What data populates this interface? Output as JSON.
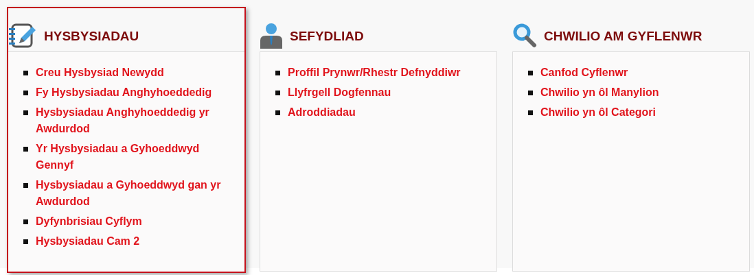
{
  "panels": [
    {
      "title": "HYSBYSIADAU",
      "kind": "notepad",
      "highlighted": true,
      "links": [
        "Creu Hysbysiad Newydd",
        "Fy Hysbysiadau Anghyhoeddedig",
        "Hysbysiadau Anghyhoeddedig yr Awdurdod",
        "Yr Hysbysiadau a Gyhoeddwyd Gennyf",
        "Hysbysiadau a Gyhoeddwyd gan yr Awdurdod",
        "Dyfynbrisiau Cyflym",
        "Hysbysiadau Cam 2"
      ]
    },
    {
      "title": "SEFYDLIAD",
      "kind": "person",
      "highlighted": false,
      "links": [
        "Proffil Prynwr/Rhestr Defnyddiwr",
        "Llyfrgell Dogfennau",
        "Adroddiadau"
      ]
    },
    {
      "title": "CHWILIO AM GYFLENWR",
      "kind": "search",
      "highlighted": false,
      "links": [
        "Canfod Cyflenwr",
        "Chwilio yn ôl Manylion",
        "Chwilio yn ôl Categori"
      ]
    }
  ]
}
